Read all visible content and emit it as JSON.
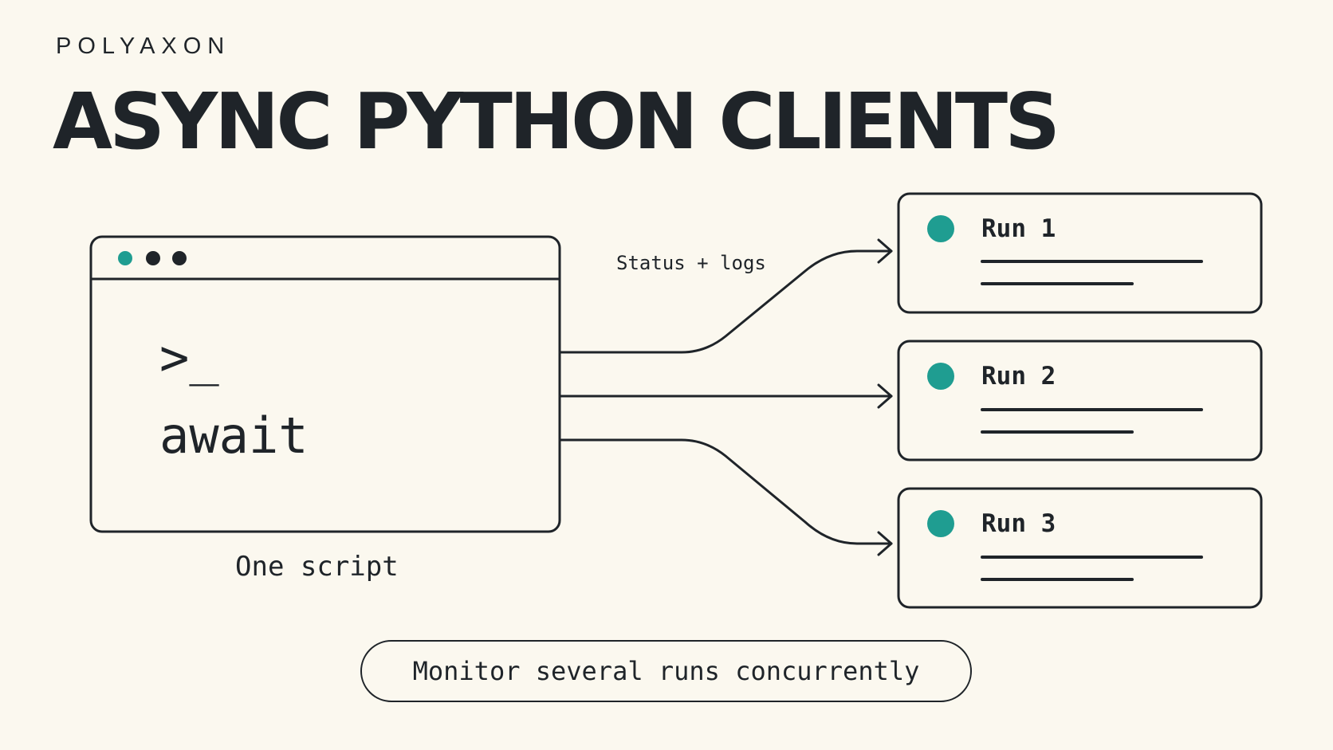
{
  "brand": "POLYAXON",
  "title": "ASYNC PYTHON CLIENTS",
  "terminal": {
    "prompt": ">_",
    "command": "await",
    "caption": "One script"
  },
  "flow_label": "Status + logs",
  "runs": [
    {
      "label": "Run 1"
    },
    {
      "label": "Run 2"
    },
    {
      "label": "Run 3"
    }
  ],
  "footer": "Monitor several runs concurrently",
  "colors": {
    "background": "#fbf8ef",
    "ink": "#1f2429",
    "accent": "#1f9d91"
  }
}
